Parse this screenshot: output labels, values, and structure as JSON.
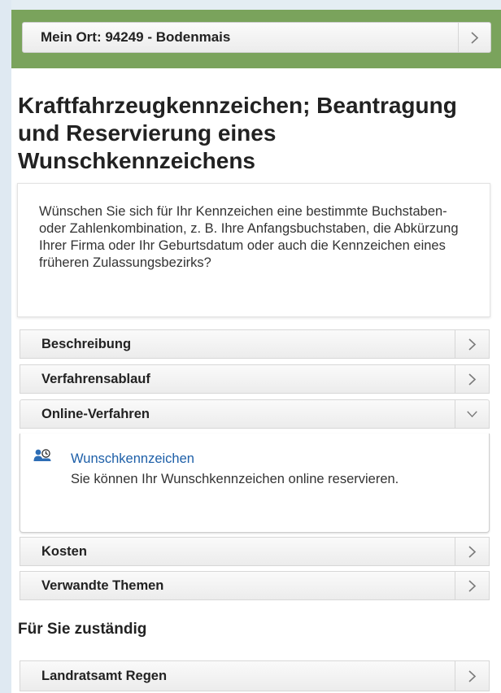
{
  "location": {
    "label": "Mein Ort: 94249 - Bodenmais"
  },
  "page_title": "Kraftfahrzeugkennzeichen; Beantragung und Reservierung eines Wunschkennzeichens",
  "intro_text": "Wünschen Sie sich für Ihr Kennzeichen eine bestimmte Buchstaben- oder Zahlenkombination, z. B. Ihre Anfangsbuchstaben, die Abkürzung Ihrer Firma oder Ihr Geburtsdatum oder auch die Kennzeichen eines früheren Zulassungsbezirks?",
  "accordion": [
    {
      "label": "Beschreibung",
      "state": "collapsed"
    },
    {
      "label": "Verfahrensablauf",
      "state": "collapsed"
    },
    {
      "label": "Online-Verfahren",
      "state": "expanded"
    },
    {
      "label": "Kosten",
      "state": "collapsed"
    },
    {
      "label": "Verwandte Themen",
      "state": "collapsed"
    }
  ],
  "online_service": {
    "link_label": "Wunschkennzeichen",
    "description": "Sie können Ihr Wunschkennzeichen online reservieren.",
    "icon": "online-service-icon"
  },
  "responsible_heading": "Für Sie zuständig",
  "authority": {
    "label": "Landratsamt Regen"
  },
  "colors": {
    "accent_green": "#7aa35c",
    "link_blue": "#1d5fa8"
  }
}
